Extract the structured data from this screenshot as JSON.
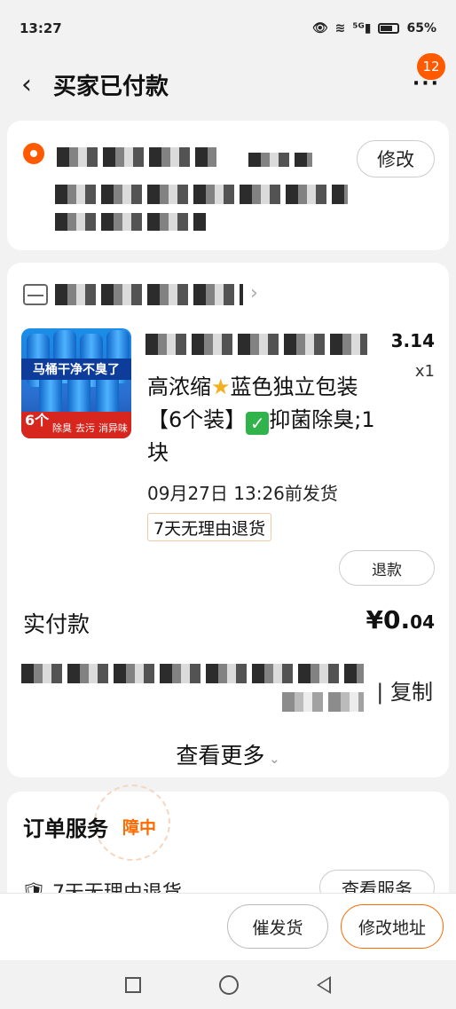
{
  "status_bar": {
    "time": "13:27",
    "icons": [
      "eye-icon",
      "wifi-icon",
      "signal-5g-icon",
      "battery-icon"
    ],
    "battery": "65%"
  },
  "nav": {
    "title": "买家已付款",
    "back_icon": "chevron-left-icon",
    "more_icon": "more-dots-icon",
    "badge": "12"
  },
  "address": {
    "edit_label": "修改",
    "icon": "location-pin-icon"
  },
  "order": {
    "shop_icon": "shop-icon",
    "product": {
      "image_banner": "马桶干净不臭了",
      "image_count": "6个",
      "image_tags": [
        "除臭",
        "去污",
        "消异味"
      ],
      "price": "3.14",
      "qty": "x1",
      "title_part1": "高浓缩",
      "title_part2": "蓝色独立包装【6个装】",
      "title_part3": "抑菌除臭;1块",
      "ship_time": "09月27日 13:26前发货",
      "tag": "7天无理由退货",
      "refund_label": "退款"
    },
    "pay_label": "实付款",
    "pay_amount_main": "¥0.",
    "pay_amount_small": "04",
    "copy_label": "| 复制",
    "more_label": "查看更多"
  },
  "service": {
    "title": "订单服务",
    "guarantee": "障中",
    "row_text": "7天无理由退货",
    "row_button": "查看服务"
  },
  "bottom_bar": {
    "urge_label": "催发货",
    "change_address_label": "修改地址"
  }
}
